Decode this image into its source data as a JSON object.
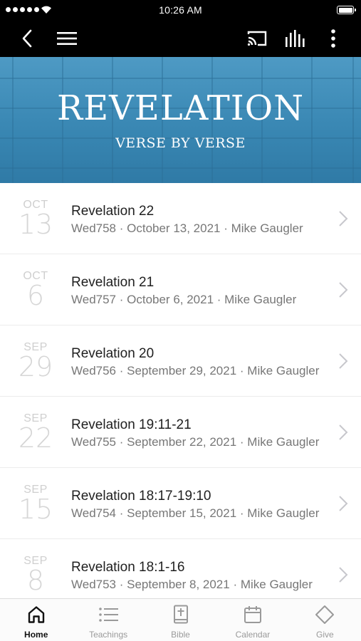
{
  "status_bar": {
    "time": "10:26 AM",
    "signal_icon": "signal-dots-icon",
    "wifi_icon": "wifi-icon",
    "battery_icon": "battery-icon"
  },
  "nav": {
    "left_icons": [
      "back-chevron-icon",
      "hamburger-menu-icon"
    ],
    "right_icons": [
      "cast-icon",
      "audio-bars-icon",
      "more-vertical-icon"
    ]
  },
  "banner": {
    "title": "REVELATION",
    "subtitle": "VERSE BY VERSE",
    "color": "#3b89b5"
  },
  "teachings": [
    {
      "month": "OCT",
      "day": "13",
      "title": "Revelation 22",
      "subtitle": "Wed758 · October 13, 2021 · Mike Gaugler"
    },
    {
      "month": "OCT",
      "day": "6",
      "title": "Revelation 21",
      "subtitle": "Wed757 · October 6, 2021 · Mike Gaugler"
    },
    {
      "month": "SEP",
      "day": "29",
      "title": "Revelation 20",
      "subtitle": "Wed756 · September 29, 2021 · Mike Gaugler"
    },
    {
      "month": "SEP",
      "day": "22",
      "title": "Revelation 19:11-21",
      "subtitle": "Wed755 · September 22, 2021 · Mike Gaugler"
    },
    {
      "month": "SEP",
      "day": "15",
      "title": "Revelation 18:17-19:10",
      "subtitle": "Wed754 · September 15, 2021 · Mike Gaugler"
    },
    {
      "month": "SEP",
      "day": "8",
      "title": "Revelation 18:1-16",
      "subtitle": "Wed753 · September 8, 2021 · Mike Gaugler"
    }
  ],
  "tabs": [
    {
      "label": "Home",
      "icon": "home-icon",
      "active": true
    },
    {
      "label": "Teachings",
      "icon": "list-icon",
      "active": false
    },
    {
      "label": "Bible",
      "icon": "bible-icon",
      "active": false
    },
    {
      "label": "Calendar",
      "icon": "calendar-icon",
      "active": false
    },
    {
      "label": "Give",
      "icon": "diamond-icon",
      "active": false
    }
  ]
}
